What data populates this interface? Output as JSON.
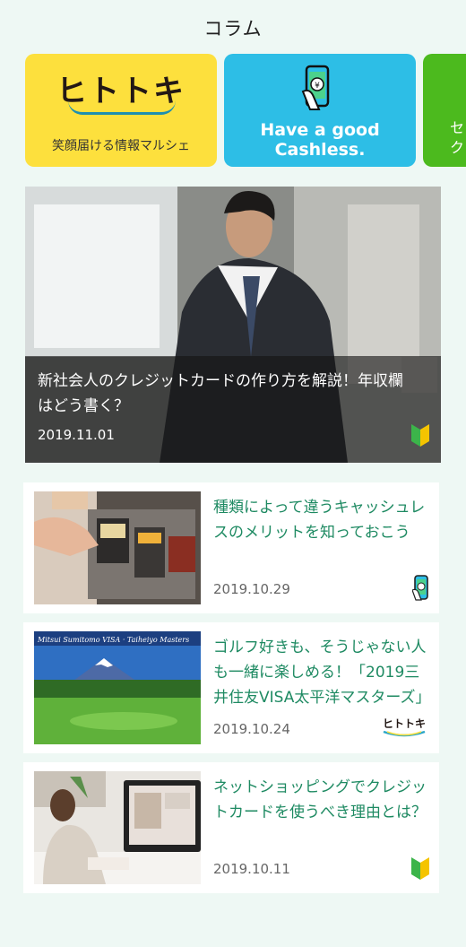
{
  "header": {
    "title": "コラム"
  },
  "categories": [
    {
      "logo_text": "ヒトトキ",
      "subtitle": "笑顔届ける情報マルシェ"
    },
    {
      "text_line1": "Have a good",
      "text_line2": "Cashless."
    },
    {
      "text_line1": "セ",
      "text_line2": "ク"
    }
  ],
  "featured": {
    "title": "新社会人のクレジットカードの作り方を解説！年収欄はどう書く？",
    "date": "2019.11.01",
    "badge_icon": "beginner-mark-icon"
  },
  "articles": [
    {
      "title": "種類によって違うキャッシュレスのメリットを知っておこう",
      "date": "2019.10.29",
      "badge_icon": "cashless-phone-icon"
    },
    {
      "title": "ゴルフ好きも、そうじゃない人も一緒に楽しめる！「2019三井住友VISA太平洋マスターズ」",
      "date": "2019.10.24",
      "badge_icon": "hitotoki-logo-icon",
      "badge_text": "ヒトトキ",
      "thumb_banner": "Mitsui Sumitomo VISA · Taiheiyo Masters"
    },
    {
      "title": "ネットショッピングでクレジットカードを使うべき理由とは？",
      "date": "2019.10.11",
      "badge_icon": "beginner-mark-icon"
    }
  ],
  "colors": {
    "accent_green": "#1e8a62",
    "hitotoki_yellow": "#fde03d",
    "cashless_blue": "#2dbee6",
    "category_green": "#4cba1e"
  }
}
